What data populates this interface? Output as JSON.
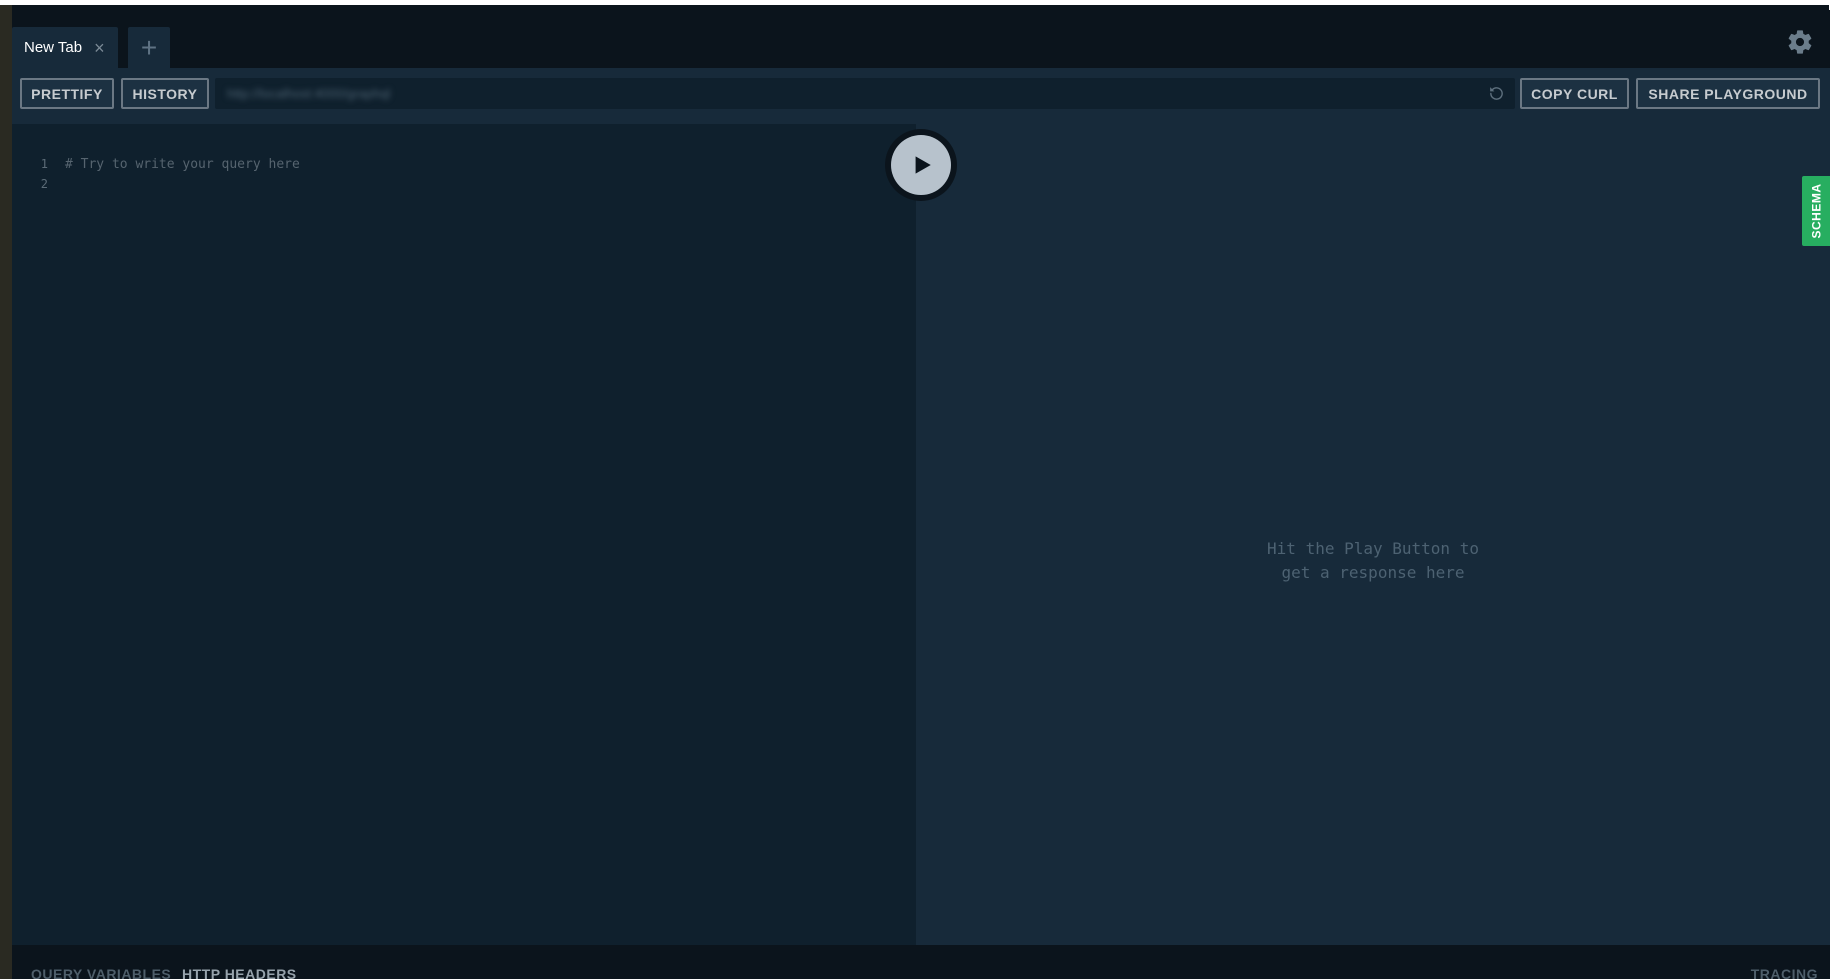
{
  "tabs": [
    {
      "label": "New Tab",
      "close_glyph": "×"
    }
  ],
  "new_tab_glyph": "+",
  "icons": {
    "settings": "gear-icon",
    "reload": "reload-icon",
    "play": "play-icon",
    "close": "close-icon",
    "add": "plus-icon"
  },
  "toolbar": {
    "prettify_label": "PRETTIFY",
    "history_label": "HISTORY",
    "endpoint_url": "http://localhost:4000/graphql",
    "copy_curl_label": "COPY CURL",
    "share_label": "SHARE PLAYGROUND"
  },
  "editor": {
    "line_numbers": [
      "1",
      "2"
    ],
    "lines": [
      "# Try to write your query here",
      ""
    ]
  },
  "result": {
    "hint_line1": "Hit the Play Button to",
    "hint_line2": "get a response here"
  },
  "schema_label": "SCHEMA",
  "bottom": {
    "query_variables_label": "QUERY VARIABLES",
    "http_headers_label": "HTTP HEADERS",
    "tracing_label": "TRACING"
  },
  "colors": {
    "accent_schema": "#27ae60",
    "background_dark": "#0b141c",
    "editor_bg": "#0f202d",
    "result_bg": "#172a3a"
  }
}
